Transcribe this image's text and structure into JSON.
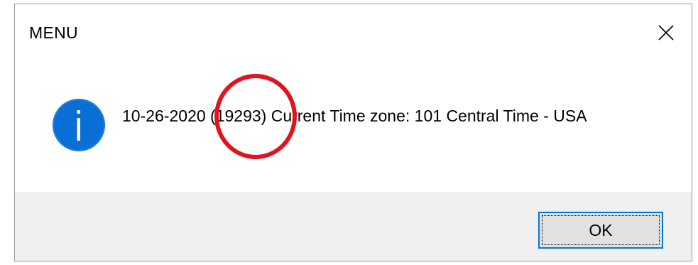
{
  "dialog": {
    "title": "MENU",
    "close_icon": "close-icon",
    "info_icon": "info-icon",
    "message": "10-26-2020 (19293) Current Time zone: 101  Central Time - USA",
    "ok_label": "OK"
  },
  "colors": {
    "info_icon_fill": "#0a6fd4",
    "ok_border": "#0078d7",
    "footer_bg": "#f0f0f0",
    "annotation": "#e0141e"
  }
}
